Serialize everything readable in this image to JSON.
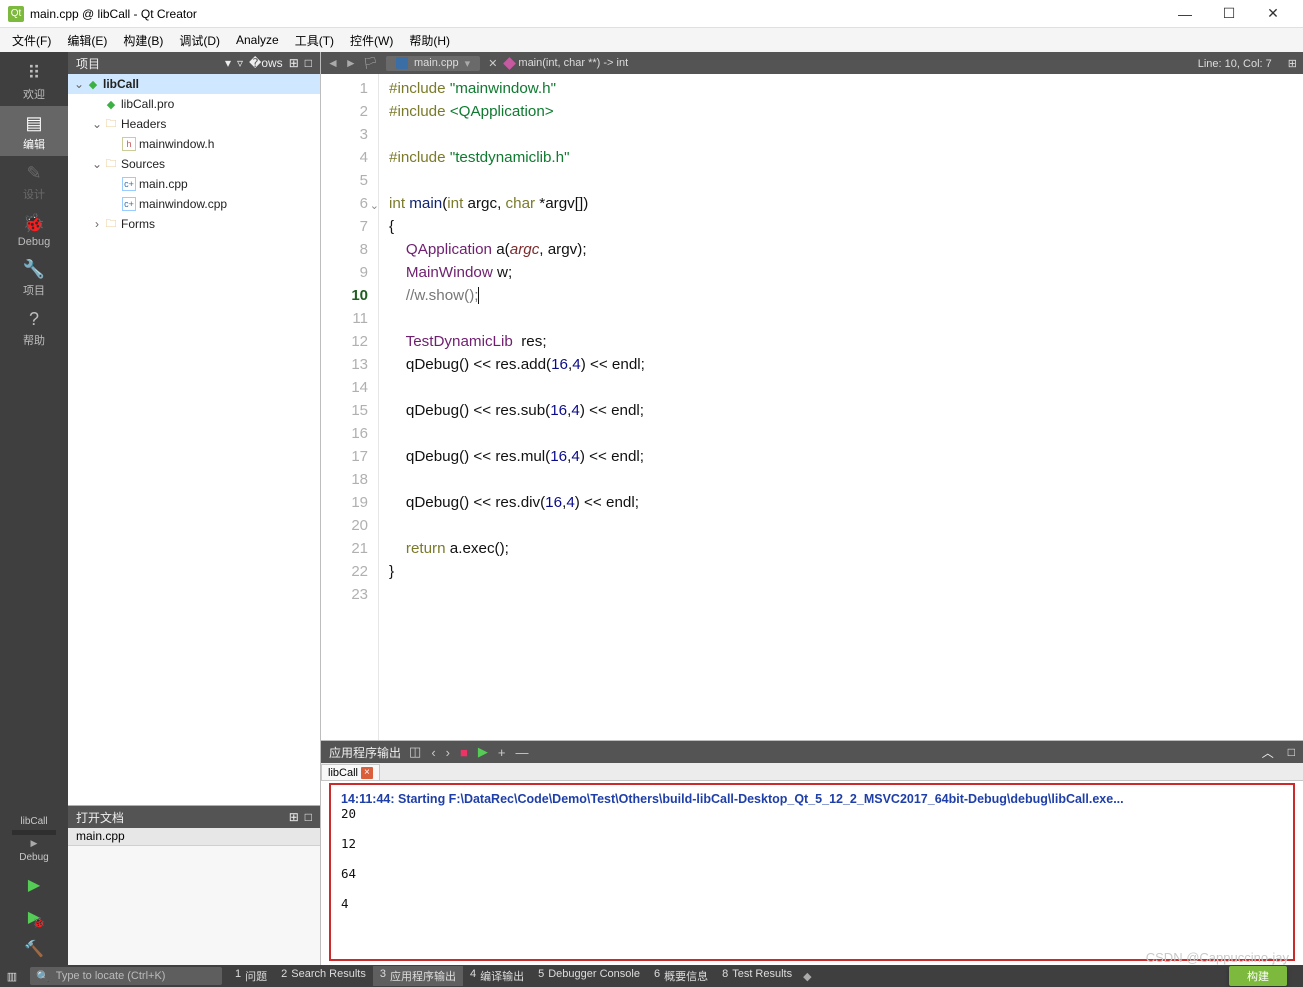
{
  "window": {
    "title": "main.cpp @ libCall - Qt Creator"
  },
  "menu": [
    "文件(F)",
    "编辑(E)",
    "构建(B)",
    "调试(D)",
    "Analyze",
    "工具(T)",
    "控件(W)",
    "帮助(H)"
  ],
  "modes": [
    {
      "icon": "⠿",
      "label": "欢迎"
    },
    {
      "icon": "▤",
      "label": "编辑",
      "selected": true
    },
    {
      "icon": "✎",
      "label": "设计",
      "dim": true
    },
    {
      "icon": "🐞",
      "label": "Debug"
    },
    {
      "icon": "🔧",
      "label": "项目"
    },
    {
      "icon": "?",
      "label": "帮助"
    }
  ],
  "kit": {
    "name": "libCall",
    "mode": "Debug"
  },
  "projectPanel": {
    "title": "项目",
    "tools": [
      "▾",
      "▿",
      "�ows",
      "⊞",
      "□"
    ],
    "tree": [
      {
        "d": 0,
        "exp": "v",
        "ico": "qt",
        "label": "libCall",
        "sel": true,
        "bold": true
      },
      {
        "d": 1,
        "exp": "",
        "ico": "qt",
        "label": "libCall.pro"
      },
      {
        "d": 1,
        "exp": "v",
        "ico": "fold",
        "label": "Headers"
      },
      {
        "d": 2,
        "exp": "",
        "ico": "h",
        "label": "mainwindow.h"
      },
      {
        "d": 1,
        "exp": "v",
        "ico": "fold",
        "label": "Sources"
      },
      {
        "d": 2,
        "exp": "",
        "ico": "c",
        "label": "main.cpp"
      },
      {
        "d": 2,
        "exp": "",
        "ico": "c",
        "label": "mainwindow.cpp"
      },
      {
        "d": 1,
        "exp": ">",
        "ico": "fold",
        "label": "Forms"
      }
    ]
  },
  "openFiles": {
    "title": "打开文档",
    "items": [
      "main.cpp"
    ]
  },
  "editor": {
    "crumb_file": "main.cpp",
    "crumb_func": "main(int, char **) -> int",
    "line": 10,
    "col": 7,
    "status_prefix": "Line: ",
    "status_mid": ", Col: ",
    "lines": [
      {
        "n": 1,
        "html": "<span class='kwd'>#include</span> <span class='str'>\"mainwindow.h\"</span>"
      },
      {
        "n": 2,
        "html": "<span class='kwd'>#include</span> <span class='str'>&lt;QApplication&gt;</span>"
      },
      {
        "n": 3,
        "html": ""
      },
      {
        "n": 4,
        "html": "<span class='kwd'>#include</span> <span class='str'>\"testdynamiclib.h\"</span>"
      },
      {
        "n": 5,
        "html": ""
      },
      {
        "n": 6,
        "html": "<span class='kwd'>int</span> <span class='fnname'>main</span>(<span class='kwd'>int</span> argc, <span class='kwd'>char</span> *argv[])",
        "fold": true
      },
      {
        "n": 7,
        "html": "{"
      },
      {
        "n": 8,
        "html": "    <span class='typ'>QApplication</span> a(<span class='args'>argc</span>, argv);"
      },
      {
        "n": 9,
        "html": "    <span class='typ'>MainWindow</span> w;"
      },
      {
        "n": 10,
        "html": "    <span class='cmt'>//w.show();</span><span class='cursor'></span>",
        "cur": true
      },
      {
        "n": 11,
        "html": ""
      },
      {
        "n": 12,
        "html": "    <span class='typ'>TestDynamicLib</span>  res;"
      },
      {
        "n": 13,
        "html": "    qDebug() &lt;&lt; res.add(<span class='num'>16</span>,<span class='num'>4</span>) &lt;&lt; endl;"
      },
      {
        "n": 14,
        "html": ""
      },
      {
        "n": 15,
        "html": "    qDebug() &lt;&lt; res.sub(<span class='num'>16</span>,<span class='num'>4</span>) &lt;&lt; endl;"
      },
      {
        "n": 16,
        "html": ""
      },
      {
        "n": 17,
        "html": "    qDebug() &lt;&lt; res.mul(<span class='num'>16</span>,<span class='num'>4</span>) &lt;&lt; endl;"
      },
      {
        "n": 18,
        "html": ""
      },
      {
        "n": 19,
        "html": "    qDebug() &lt;&lt; res.div(<span class='num'>16</span>,<span class='num'>4</span>) &lt;&lt; endl;"
      },
      {
        "n": 20,
        "html": ""
      },
      {
        "n": 21,
        "html": "    <span class='kwd'>return</span> a.exec();"
      },
      {
        "n": 22,
        "html": "}"
      },
      {
        "n": 23,
        "html": ""
      }
    ]
  },
  "output": {
    "title": "应用程序输出",
    "tab": "libCall",
    "start_prefix": "14:11:44: Starting ",
    "start_path": "F:\\DataRec\\Code\\Demo\\Test\\Others\\build-libCall-Desktop_Qt_5_12_2_MSVC2017_64bit-Debug\\debug\\libCall.exe...",
    "lines": [
      "20",
      "",
      "12",
      "",
      "64",
      "",
      "4"
    ]
  },
  "status": {
    "locate": "Type to locate (Ctrl+K)",
    "tabs": [
      {
        "n": "1",
        "l": "问题"
      },
      {
        "n": "2",
        "l": "Search Results"
      },
      {
        "n": "3",
        "l": "应用程序输出",
        "sel": true
      },
      {
        "n": "4",
        "l": "编译输出"
      },
      {
        "n": "5",
        "l": "Debugger Console"
      },
      {
        "n": "6",
        "l": "概要信息"
      },
      {
        "n": "8",
        "l": "Test Results"
      }
    ],
    "build": "构建"
  },
  "watermark": "CSDN @Cappuccino-jay"
}
